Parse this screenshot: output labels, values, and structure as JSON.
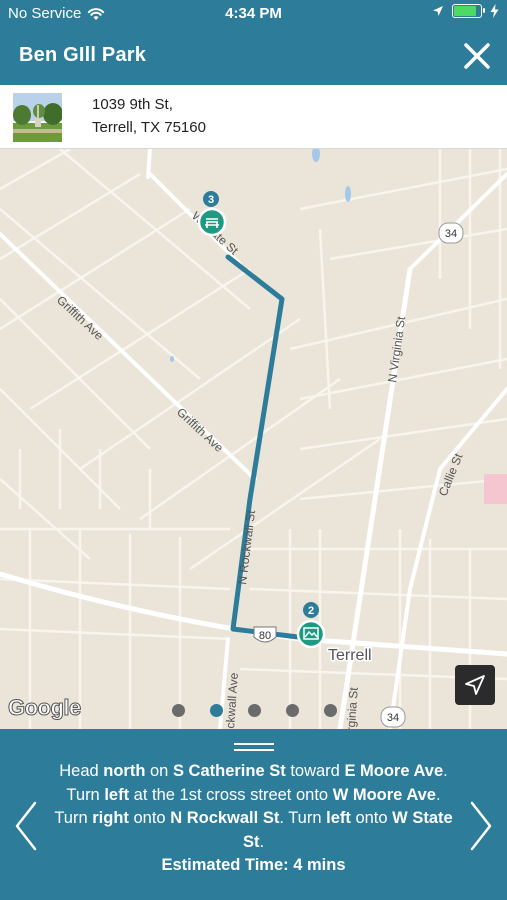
{
  "status": {
    "carrier": "No Service",
    "time": "4:34 PM",
    "battery_level": 0.85
  },
  "header": {
    "title": "Ben GIll Park"
  },
  "address": {
    "line1": "1039 9th St,",
    "line2": "Terrell, TX 75160"
  },
  "map": {
    "waypoints": [
      {
        "number": "3",
        "icon": "park-bench-icon"
      },
      {
        "number": "2",
        "icon": "park-icon"
      }
    ],
    "road_labels": {
      "state_st": "W State St",
      "griffith_1": "Griffith Ave",
      "griffith_2": "Griffith Ave",
      "virginia_n": "N Virginia St",
      "rockwall_n": "N Rockwall St",
      "callie": "Callie St",
      "rockwall_s": "Rockwall Ave",
      "virginia_s": "Virginia St",
      "city": "Terrell"
    },
    "shields": {
      "hwy34_top": "34",
      "us80": "80",
      "hwy34_bottom": "34"
    },
    "attribution": "Google",
    "page_dots": 5,
    "active_dot": 1
  },
  "directions": {
    "segments": [
      {
        "text": "Head ",
        "bold": false
      },
      {
        "text": "north",
        "bold": true
      },
      {
        "text": " on ",
        "bold": false
      },
      {
        "text": "S Catherine St",
        "bold": true
      },
      {
        "text": " toward ",
        "bold": false
      },
      {
        "text": "E Moore Ave",
        "bold": true
      },
      {
        "text": ". Turn ",
        "bold": false
      },
      {
        "text": "left",
        "bold": true
      },
      {
        "text": " at the 1st cross street onto ",
        "bold": false
      },
      {
        "text": "W Moore Ave",
        "bold": true
      },
      {
        "text": ". Turn ",
        "bold": false
      },
      {
        "text": "right",
        "bold": true
      },
      {
        "text": " onto ",
        "bold": false
      },
      {
        "text": "N Rockwall St",
        "bold": true
      },
      {
        "text": ". Turn ",
        "bold": false
      },
      {
        "text": "left",
        "bold": true
      },
      {
        "text": " onto ",
        "bold": false
      },
      {
        "text": "W State St",
        "bold": true
      },
      {
        "text": ".",
        "bold": false
      }
    ],
    "estimated_time": "Estimated Time: 4 mins"
  },
  "colors": {
    "primary": "#2d7d9a",
    "route": "#2d7d9a",
    "marker": "#1e9a82",
    "map_bg": "#ebe4d9",
    "water": "#a4c8ea"
  }
}
